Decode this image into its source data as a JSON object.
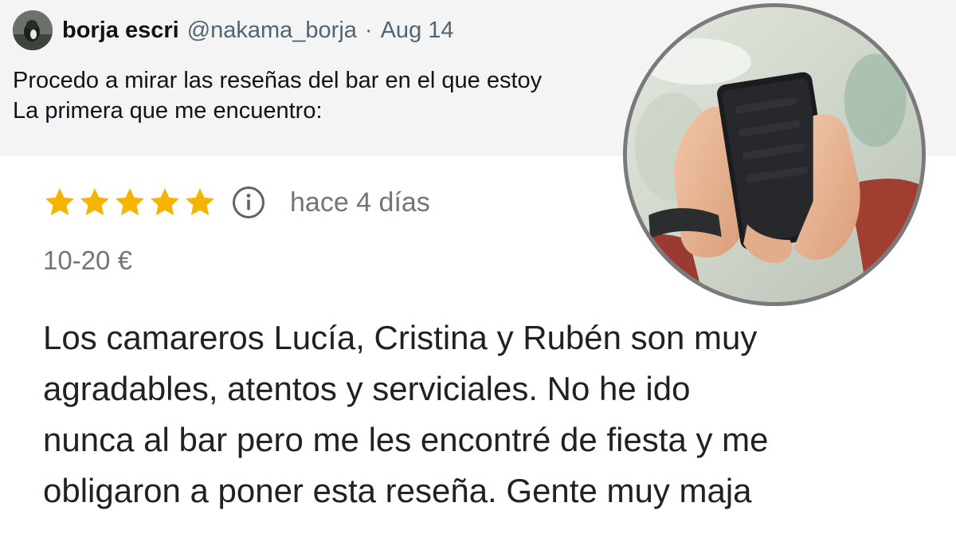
{
  "tweet": {
    "display_name": "borja escri",
    "handle": "@nakama_borja",
    "separator": "·",
    "date": "Aug 14",
    "lines": [
      "Procedo a mirar las reseñas del bar en el que estoy",
      "La primera que me encuentro:"
    ]
  },
  "review": {
    "rating": 5,
    "rating_max": 5,
    "star_color": "#f6b400",
    "info_icon": "info-circle-icon",
    "date": "hace 4 días",
    "price": "10-20 €",
    "body_lines": [
      "Los camareros Lucía, Cristina y Rubén son muy",
      "agradables, atentos y serviciales. No he ido",
      "nunca al bar pero me les encontré de fiesta y me",
      "obligaron a poner esta reseña. Gente muy maja"
    ]
  },
  "photo": {
    "subject": "hands-holding-smartphone-photo"
  }
}
